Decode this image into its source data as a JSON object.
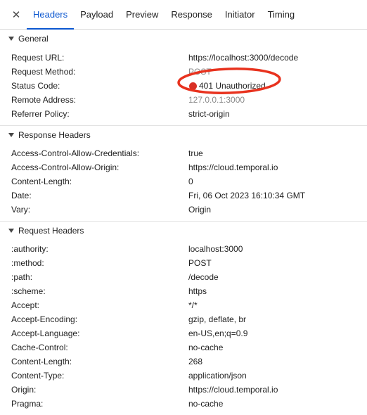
{
  "tabs": {
    "close_label": "✕",
    "items": [
      "Headers",
      "Payload",
      "Preview",
      "Response",
      "Initiator",
      "Timing"
    ]
  },
  "general": {
    "title": "General",
    "rows": [
      {
        "key": "Request URL:",
        "value": "https://localhost:3000/decode"
      },
      {
        "key": "Request Method:",
        "value": "POST"
      },
      {
        "key": "Status Code:",
        "value": "401 Unauthorized"
      },
      {
        "key": "Remote Address:",
        "value": "127.0.0.1:3000"
      },
      {
        "key": "Referrer Policy:",
        "value": "strict-origin"
      }
    ]
  },
  "response_headers": {
    "title": "Response Headers",
    "rows": [
      {
        "key": "Access-Control-Allow-Credentials:",
        "value": "true"
      },
      {
        "key": "Access-Control-Allow-Origin:",
        "value": "https://cloud.temporal.io"
      },
      {
        "key": "Content-Length:",
        "value": "0"
      },
      {
        "key": "Date:",
        "value": "Fri, 06 Oct 2023 16:10:34 GMT"
      },
      {
        "key": "Vary:",
        "value": "Origin"
      }
    ]
  },
  "request_headers": {
    "title": "Request Headers",
    "rows": [
      {
        "key": ":authority:",
        "value": "localhost:3000"
      },
      {
        "key": ":method:",
        "value": "POST"
      },
      {
        "key": ":path:",
        "value": "/decode"
      },
      {
        "key": ":scheme:",
        "value": "https"
      },
      {
        "key": "Accept:",
        "value": "*/*"
      },
      {
        "key": "Accept-Encoding:",
        "value": "gzip, deflate, br"
      },
      {
        "key": "Accept-Language:",
        "value": "en-US,en;q=0.9"
      },
      {
        "key": "Cache-Control:",
        "value": "no-cache"
      },
      {
        "key": "Content-Length:",
        "value": "268"
      },
      {
        "key": "Content-Type:",
        "value": "application/json"
      },
      {
        "key": "Origin:",
        "value": "https://cloud.temporal.io"
      },
      {
        "key": "Pragma:",
        "value": "no-cache"
      }
    ]
  },
  "colors": {
    "accent": "#0b57d0",
    "status_error": "#d93025",
    "annotation": "#e8321e"
  },
  "icons": {
    "close": "close-icon",
    "collapse": "triangle-down-icon",
    "status": "status-error-dot-icon"
  }
}
